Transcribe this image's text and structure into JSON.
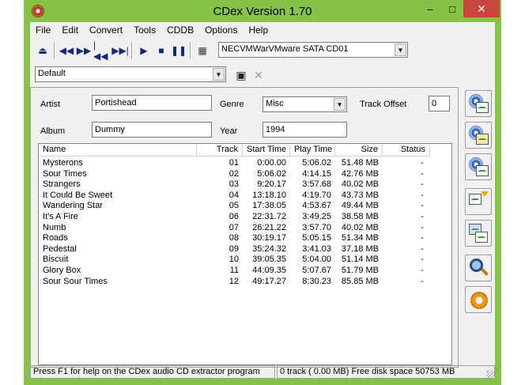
{
  "window": {
    "title": "CDex Version 1.70",
    "minimize": "‒",
    "maximize": "□",
    "close": "✕"
  },
  "menu": [
    "File",
    "Edit",
    "Convert",
    "Tools",
    "CDDB",
    "Options",
    "Help"
  ],
  "toolbar": {
    "drive_select": "NECVMWarVMware SATA CD01",
    "profile_select": "Default"
  },
  "fields": {
    "artist_label": "Artist",
    "artist_value": "Portishead",
    "album_label": "Album",
    "album_value": "Dummy",
    "genre_label": "Genre",
    "genre_value": "Misc",
    "year_label": "Year",
    "year_value": "1994",
    "track_offset_label": "Track Offset",
    "track_offset_value": "0"
  },
  "tracklist": {
    "columns": [
      "Name",
      "Track",
      "Start Time",
      "Play Time",
      "Size",
      "Status"
    ],
    "rows": [
      [
        "Mysterons",
        "01",
        "0:00.00",
        "5:06.02",
        "51.48 MB",
        "-"
      ],
      [
        "Sour Times",
        "02",
        "5:06.02",
        "4:14.15",
        "42.76 MB",
        "-"
      ],
      [
        "Strangers",
        "03",
        "9:20.17",
        "3:57.68",
        "40.02 MB",
        "-"
      ],
      [
        "It Could Be Sweet",
        "04",
        "13:18.10",
        "4:19.70",
        "43.73 MB",
        "-"
      ],
      [
        "Wandering Star",
        "05",
        "17:38.05",
        "4:53.67",
        "49.44 MB",
        "-"
      ],
      [
        "It's A Fire",
        "06",
        "22:31.72",
        "3:49.25",
        "38.58 MB",
        "-"
      ],
      [
        "Numb",
        "07",
        "26:21.22",
        "3:57.70",
        "40.02 MB",
        "-"
      ],
      [
        "Roads",
        "08",
        "30:19.17",
        "5:05.15",
        "51.34 MB",
        "-"
      ],
      [
        "Pedestal",
        "09",
        "35:24.32",
        "3:41.03",
        "37.18 MB",
        "-"
      ],
      [
        "Biscuit",
        "10",
        "39:05.35",
        "5:04.00",
        "51.14 MB",
        "-"
      ],
      [
        "Glory Box",
        "11",
        "44:09.35",
        "5:07.67",
        "51.79 MB",
        "-"
      ],
      [
        "Sour Sour Times",
        "12",
        "49:17.27",
        "8:30.23",
        "85.85 MB",
        "-"
      ]
    ]
  },
  "status": {
    "help": "Press F1 for help on the CDex audio CD extractor program",
    "info": "0 track ( 0.00 MB) Free disk space 50753 MB"
  },
  "colors": {
    "titlebar": "#86c246",
    "close": "#c7463e",
    "toolbar_icon": "#14287a"
  },
  "icons": {
    "toolbar": [
      "eject-icon",
      "rewind-icon",
      "fast-forward-icon",
      "skip-back-icon",
      "skip-forward-icon",
      "play-icon",
      "stop-icon",
      "pause-icon",
      "cd-info-icon"
    ],
    "sidebar": [
      "extract-cd-to-wav-icon",
      "extract-cd-to-compressed-icon",
      "extract-partial-track-icon",
      "convert-wav-to-compressed-icon",
      "convert-compressed-to-wav-icon",
      "cddb-query-icon",
      "configuration-icon"
    ]
  }
}
